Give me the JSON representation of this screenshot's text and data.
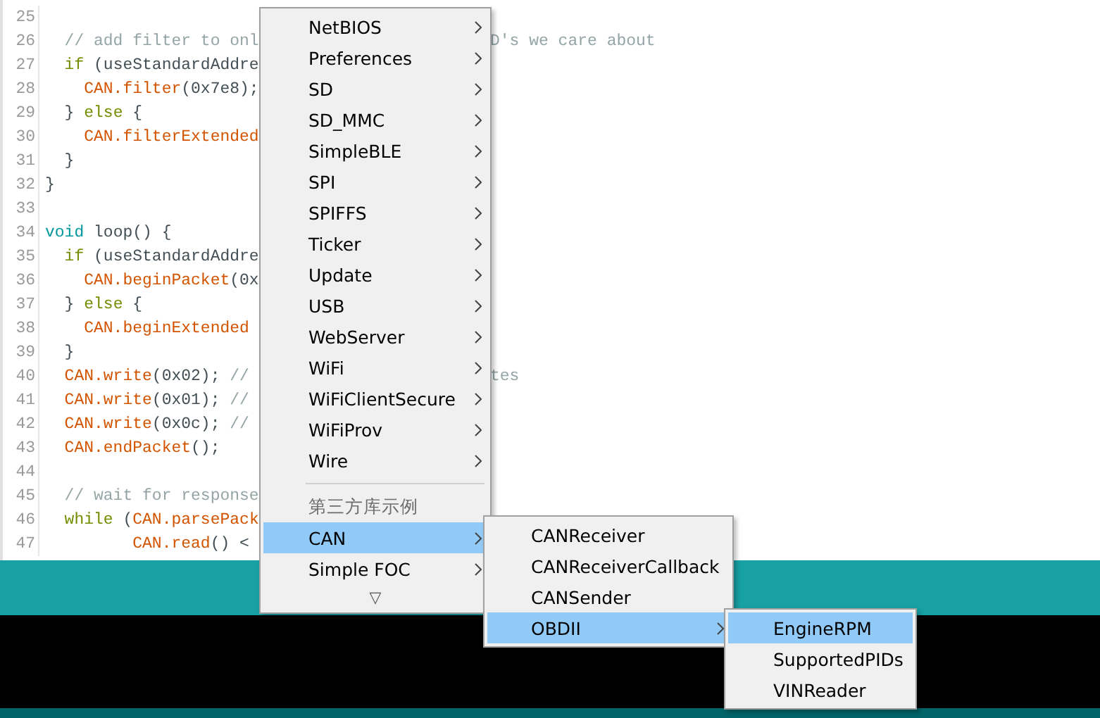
{
  "editor": {
    "lines": [
      {
        "number": "25"
      },
      {
        "number": "26",
        "code": [
          {
            "kind": "comment",
            "text": "  // add filter to onl"
          }
        ],
        "tail": [
          {
            "kind": "comment",
            "text": "D's we care about"
          }
        ]
      },
      {
        "number": "27",
        "code": [
          {
            "kind": "keyword",
            "text": "  if"
          },
          {
            "kind": "plain",
            "text": " (useStandardAddre"
          }
        ]
      },
      {
        "number": "28",
        "code": [
          {
            "kind": "object",
            "text": "    CAN.filter"
          },
          {
            "kind": "plain",
            "text": "(0x7e8);"
          }
        ]
      },
      {
        "number": "29",
        "code": [
          {
            "kind": "plain",
            "text": "  } "
          },
          {
            "kind": "keyword",
            "text": "else"
          },
          {
            "kind": "plain",
            "text": " {"
          }
        ]
      },
      {
        "number": "30",
        "code": [
          {
            "kind": "object",
            "text": "    CAN.filterExtended"
          }
        ]
      },
      {
        "number": "31",
        "code": [
          {
            "kind": "plain",
            "text": "  }"
          }
        ]
      },
      {
        "number": "32",
        "code": [
          {
            "kind": "plain",
            "text": "}"
          }
        ]
      },
      {
        "number": "33"
      },
      {
        "number": "34",
        "code": [
          {
            "kind": "type",
            "text": "void"
          },
          {
            "kind": "plain",
            "text": " loop() {"
          }
        ]
      },
      {
        "number": "35",
        "code": [
          {
            "kind": "keyword",
            "text": "  if"
          },
          {
            "kind": "plain",
            "text": " (useStandardAddre"
          }
        ]
      },
      {
        "number": "36",
        "code": [
          {
            "kind": "object",
            "text": "    CAN.beginPacket"
          },
          {
            "kind": "plain",
            "text": "(0x"
          }
        ]
      },
      {
        "number": "37",
        "code": [
          {
            "kind": "plain",
            "text": "  } "
          },
          {
            "kind": "keyword",
            "text": "else"
          },
          {
            "kind": "plain",
            "text": " {"
          }
        ]
      },
      {
        "number": "38",
        "code": [
          {
            "kind": "object",
            "text": "    CAN.beginExtended"
          }
        ]
      },
      {
        "number": "39",
        "code": [
          {
            "kind": "plain",
            "text": "  }"
          }
        ]
      },
      {
        "number": "40",
        "code": [
          {
            "kind": "object",
            "text": "  CAN.write"
          },
          {
            "kind": "plain",
            "text": "(0x02); "
          },
          {
            "kind": "comment",
            "text": "//"
          }
        ],
        "tail": [
          {
            "kind": "comment",
            "text": "tes"
          }
        ]
      },
      {
        "number": "41",
        "code": [
          {
            "kind": "object",
            "text": "  CAN.write"
          },
          {
            "kind": "plain",
            "text": "(0x01); "
          },
          {
            "kind": "comment",
            "text": "//"
          }
        ]
      },
      {
        "number": "42",
        "code": [
          {
            "kind": "object",
            "text": "  CAN.write"
          },
          {
            "kind": "plain",
            "text": "(0x0c); "
          },
          {
            "kind": "comment",
            "text": "//"
          }
        ]
      },
      {
        "number": "43",
        "code": [
          {
            "kind": "object",
            "text": "  CAN.endPacket"
          },
          {
            "kind": "plain",
            "text": "();"
          }
        ]
      },
      {
        "number": "44"
      },
      {
        "number": "45",
        "code": [
          {
            "kind": "comment",
            "text": "  // wait for response"
          }
        ]
      },
      {
        "number": "46",
        "code": [
          {
            "kind": "keyword",
            "text": "  while"
          },
          {
            "kind": "plain",
            "text": " ("
          },
          {
            "kind": "object",
            "text": "CAN.parsePack"
          }
        ]
      },
      {
        "number": "47",
        "code": [
          {
            "kind": "object",
            "text": "         CAN.read"
          },
          {
            "kind": "plain",
            "text": "() <"
          }
        ]
      }
    ]
  },
  "menus": [
    {
      "items": [
        {
          "kind": "item",
          "label": "NetBIOS",
          "submenu": true,
          "selected": false
        },
        {
          "kind": "item",
          "label": "Preferences",
          "submenu": true,
          "selected": false
        },
        {
          "kind": "item",
          "label": "SD",
          "submenu": true,
          "selected": false
        },
        {
          "kind": "item",
          "label": "SD_MMC",
          "submenu": true,
          "selected": false
        },
        {
          "kind": "item",
          "label": "SimpleBLE",
          "submenu": true,
          "selected": false
        },
        {
          "kind": "item",
          "label": "SPI",
          "submenu": true,
          "selected": false
        },
        {
          "kind": "item",
          "label": "SPIFFS",
          "submenu": true,
          "selected": false
        },
        {
          "kind": "item",
          "label": "Ticker",
          "submenu": true,
          "selected": false
        },
        {
          "kind": "item",
          "label": "Update",
          "submenu": true,
          "selected": false
        },
        {
          "kind": "item",
          "label": "USB",
          "submenu": true,
          "selected": false
        },
        {
          "kind": "item",
          "label": "WebServer",
          "submenu": true,
          "selected": false
        },
        {
          "kind": "item",
          "label": "WiFi",
          "submenu": true,
          "selected": false
        },
        {
          "kind": "item",
          "label": "WiFiClientSecure",
          "submenu": true,
          "selected": false
        },
        {
          "kind": "item",
          "label": "WiFiProv",
          "submenu": true,
          "selected": false
        },
        {
          "kind": "item",
          "label": "Wire",
          "submenu": true,
          "selected": false
        },
        {
          "kind": "separator"
        },
        {
          "kind": "header",
          "label": "第三方库示例"
        },
        {
          "kind": "item",
          "label": "CAN",
          "submenu": true,
          "selected": true
        },
        {
          "kind": "item",
          "label": "Simple FOC",
          "submenu": true,
          "selected": false
        },
        {
          "kind": "more",
          "label": "▽"
        }
      ]
    },
    {
      "items": [
        {
          "kind": "item",
          "label": "CANReceiver",
          "submenu": false,
          "selected": false
        },
        {
          "kind": "item",
          "label": "CANReceiverCallback",
          "submenu": false,
          "selected": false
        },
        {
          "kind": "item",
          "label": "CANSender",
          "submenu": false,
          "selected": false
        },
        {
          "kind": "item",
          "label": "OBDII",
          "submenu": true,
          "selected": true
        }
      ]
    },
    {
      "items": [
        {
          "kind": "item",
          "label": "EngineRPM",
          "submenu": false,
          "selected": true
        },
        {
          "kind": "item",
          "label": "SupportedPIDs",
          "submenu": false,
          "selected": false
        },
        {
          "kind": "item",
          "label": "VINReader",
          "submenu": false,
          "selected": false
        }
      ]
    }
  ]
}
